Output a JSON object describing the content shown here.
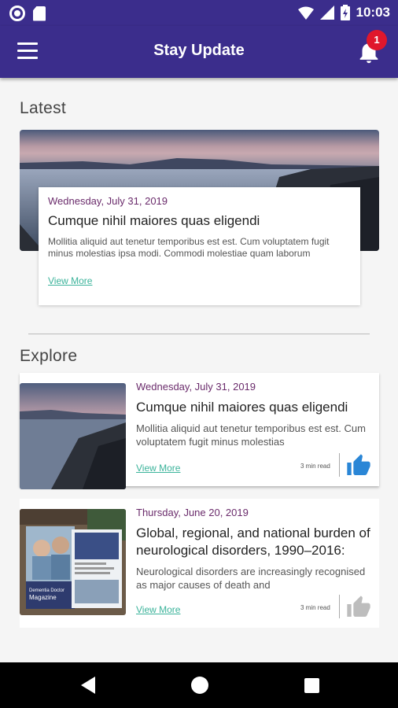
{
  "status_bar": {
    "time": "10:03"
  },
  "app_bar": {
    "title": "Stay Update",
    "notification_count": "1"
  },
  "latest": {
    "section_title": "Latest",
    "date": "Wednesday, July 31, 2019",
    "title": "Cumque nihil maiores quas eligendi",
    "body": "Mollitia aliquid aut tenetur temporibus est est. Cum voluptatem fugit minus molestias ipsa modi. Commodi molestiae quam laborum",
    "view_more": "View More"
  },
  "explore": {
    "section_title": "Explore",
    "items": [
      {
        "date": "Wednesday, July 31, 2019",
        "title": "Cumque nihil maiores quas eligendi",
        "body": "Mollitia aliquid aut tenetur temporibus est est. Cum voluptatem fugit minus molestias",
        "view_more": "View More",
        "read_time": "3 min read",
        "liked": true
      },
      {
        "date": "Thursday, June 20, 2019",
        "title": "Global, regional, and national burden of neurological disorders, 1990–2016:",
        "body": "Neurological disorders are increasingly recognised as major causes of death and",
        "view_more": "View More",
        "read_time": "3 min read",
        "liked": false,
        "image_text": "Dementia Doctor Magazine"
      }
    ]
  },
  "colors": {
    "primary": "#3b2d8c",
    "accent_date": "#6a2b6b",
    "link": "#3bb39a",
    "like_active": "#2a86d6",
    "like_inactive": "#bdbdbd",
    "badge": "#e0172c"
  }
}
